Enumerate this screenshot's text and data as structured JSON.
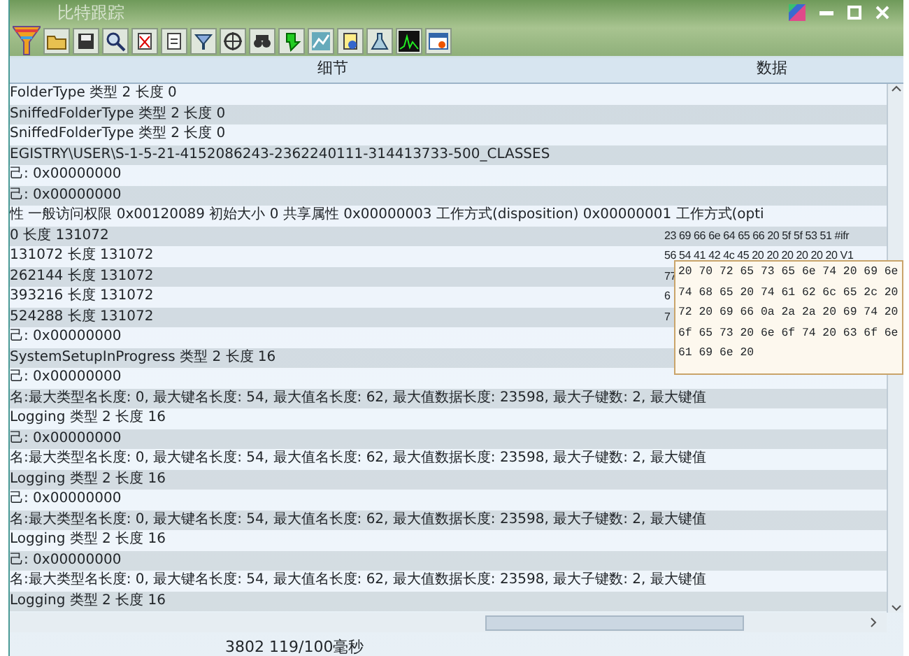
{
  "window": {
    "title": "比特跟踪"
  },
  "table": {
    "columns": [
      "细节",
      "数据"
    ],
    "rows": [
      {
        "detail": "FolderType 类型 2 长度 0",
        "data": ""
      },
      {
        "detail": "SniffedFolderType 类型 2 长度 0",
        "data": ""
      },
      {
        "detail": "SniffedFolderType 类型 2 长度 0",
        "data": ""
      },
      {
        "detail": "EGISTRY\\USER\\S-1-5-21-4152086243-2362240111-314413733-500_CLASSES",
        "data": ""
      },
      {
        "detail": "己: 0x00000000",
        "data": ""
      },
      {
        "detail": "己: 0x00000000",
        "data": ""
      },
      {
        "detail": "性 一般访问权限 0x00120089 初始大小 0 共享属性 0x00000003 工作方式(disposition) 0x00000001 工作方式(opti",
        "data": ""
      },
      {
        "detail": "0 长度 131072",
        "data": "23 69 66 6e 64 65 66 20 5f 5f 53 51 #ifr"
      },
      {
        "detail": "131072 长度 131072",
        "data": "56 54 41 42 4c 45 20 20 20 20 20 20 V1"
      },
      {
        "detail": "262144 长度 131072",
        "data": "77"
      },
      {
        "detail": "393216 长度 131072",
        "data": "6"
      },
      {
        "detail": "524288 长度 131072",
        "data": "7"
      },
      {
        "detail": "己: 0x00000000",
        "data": ""
      },
      {
        "detail": "SystemSetupInProgress 类型 2 长度 16",
        "data": ""
      },
      {
        "detail": "己: 0x00000000",
        "data": ""
      },
      {
        "detail": "名:最大类型名长度: 0, 最大键名长度: 54, 最大值名长度: 62, 最大值数据长度: 23598, 最大子键数: 2, 最大键值",
        "data": ""
      },
      {
        "detail": "Logging 类型 2 长度 16",
        "data": ""
      },
      {
        "detail": "己: 0x00000000",
        "data": ""
      },
      {
        "detail": "名:最大类型名长度: 0, 最大键名长度: 54, 最大值名长度: 62, 最大值数据长度: 23598, 最大子键数: 2, 最大键值",
        "data": ""
      },
      {
        "detail": "Logging 类型 2 长度 16",
        "data": ""
      },
      {
        "detail": "己: 0x00000000",
        "data": ""
      },
      {
        "detail": "名:最大类型名长度: 0, 最大键名长度: 54, 最大值名长度: 62, 最大值数据长度: 23598, 最大子键数: 2, 最大键值",
        "data": ""
      },
      {
        "detail": "Logging 类型 2 长度 16",
        "data": ""
      },
      {
        "detail": "己: 0x00000000",
        "data": ""
      },
      {
        "detail": "名:最大类型名长度: 0, 最大键名长度: 54, 最大值名长度: 62, 最大值数据长度: 23598, 最大子键数: 2, 最大键值",
        "data": ""
      },
      {
        "detail": "Logging 类型 2 长度 16",
        "data": ""
      }
    ]
  },
  "tooltip": {
    "lines": [
      "20 70 72 65 73 65 6e 74 20 69 6e",
      "74 68 65 20 74 61 62 6c 65 2c 20",
      "72 20 69 66 0a 2a 2a 20 69 74 20",
      "6f 65 73 20 6e 6f 74 20 63 6f 6e",
      "61 69 6e 20"
    ]
  },
  "status_bar": {
    "text": "3802  119/100毫秒"
  }
}
